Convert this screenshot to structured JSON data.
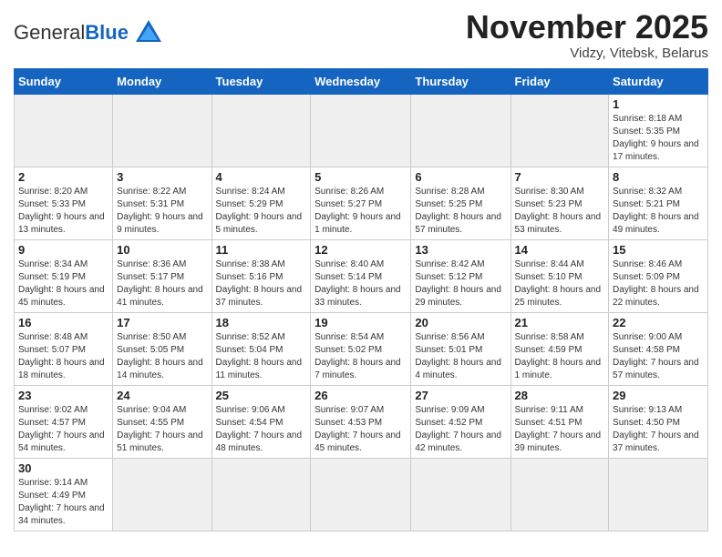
{
  "logo": {
    "general": "General",
    "blue": "Blue"
  },
  "title": "November 2025",
  "subtitle": "Vidzy, Vitebsk, Belarus",
  "days_of_week": [
    "Sunday",
    "Monday",
    "Tuesday",
    "Wednesday",
    "Thursday",
    "Friday",
    "Saturday"
  ],
  "weeks": [
    [
      {
        "day": "",
        "info": ""
      },
      {
        "day": "",
        "info": ""
      },
      {
        "day": "",
        "info": ""
      },
      {
        "day": "",
        "info": ""
      },
      {
        "day": "",
        "info": ""
      },
      {
        "day": "",
        "info": ""
      },
      {
        "day": "1",
        "info": "Sunrise: 8:18 AM\nSunset: 5:35 PM\nDaylight: 9 hours and 17 minutes."
      }
    ],
    [
      {
        "day": "2",
        "info": "Sunrise: 8:20 AM\nSunset: 5:33 PM\nDaylight: 9 hours and 13 minutes."
      },
      {
        "day": "3",
        "info": "Sunrise: 8:22 AM\nSunset: 5:31 PM\nDaylight: 9 hours and 9 minutes."
      },
      {
        "day": "4",
        "info": "Sunrise: 8:24 AM\nSunset: 5:29 PM\nDaylight: 9 hours and 5 minutes."
      },
      {
        "day": "5",
        "info": "Sunrise: 8:26 AM\nSunset: 5:27 PM\nDaylight: 9 hours and 1 minute."
      },
      {
        "day": "6",
        "info": "Sunrise: 8:28 AM\nSunset: 5:25 PM\nDaylight: 8 hours and 57 minutes."
      },
      {
        "day": "7",
        "info": "Sunrise: 8:30 AM\nSunset: 5:23 PM\nDaylight: 8 hours and 53 minutes."
      },
      {
        "day": "8",
        "info": "Sunrise: 8:32 AM\nSunset: 5:21 PM\nDaylight: 8 hours and 49 minutes."
      }
    ],
    [
      {
        "day": "9",
        "info": "Sunrise: 8:34 AM\nSunset: 5:19 PM\nDaylight: 8 hours and 45 minutes."
      },
      {
        "day": "10",
        "info": "Sunrise: 8:36 AM\nSunset: 5:17 PM\nDaylight: 8 hours and 41 minutes."
      },
      {
        "day": "11",
        "info": "Sunrise: 8:38 AM\nSunset: 5:16 PM\nDaylight: 8 hours and 37 minutes."
      },
      {
        "day": "12",
        "info": "Sunrise: 8:40 AM\nSunset: 5:14 PM\nDaylight: 8 hours and 33 minutes."
      },
      {
        "day": "13",
        "info": "Sunrise: 8:42 AM\nSunset: 5:12 PM\nDaylight: 8 hours and 29 minutes."
      },
      {
        "day": "14",
        "info": "Sunrise: 8:44 AM\nSunset: 5:10 PM\nDaylight: 8 hours and 25 minutes."
      },
      {
        "day": "15",
        "info": "Sunrise: 8:46 AM\nSunset: 5:09 PM\nDaylight: 8 hours and 22 minutes."
      }
    ],
    [
      {
        "day": "16",
        "info": "Sunrise: 8:48 AM\nSunset: 5:07 PM\nDaylight: 8 hours and 18 minutes."
      },
      {
        "day": "17",
        "info": "Sunrise: 8:50 AM\nSunset: 5:05 PM\nDaylight: 8 hours and 14 minutes."
      },
      {
        "day": "18",
        "info": "Sunrise: 8:52 AM\nSunset: 5:04 PM\nDaylight: 8 hours and 11 minutes."
      },
      {
        "day": "19",
        "info": "Sunrise: 8:54 AM\nSunset: 5:02 PM\nDaylight: 8 hours and 7 minutes."
      },
      {
        "day": "20",
        "info": "Sunrise: 8:56 AM\nSunset: 5:01 PM\nDaylight: 8 hours and 4 minutes."
      },
      {
        "day": "21",
        "info": "Sunrise: 8:58 AM\nSunset: 4:59 PM\nDaylight: 8 hours and 1 minute."
      },
      {
        "day": "22",
        "info": "Sunrise: 9:00 AM\nSunset: 4:58 PM\nDaylight: 7 hours and 57 minutes."
      }
    ],
    [
      {
        "day": "23",
        "info": "Sunrise: 9:02 AM\nSunset: 4:57 PM\nDaylight: 7 hours and 54 minutes."
      },
      {
        "day": "24",
        "info": "Sunrise: 9:04 AM\nSunset: 4:55 PM\nDaylight: 7 hours and 51 minutes."
      },
      {
        "day": "25",
        "info": "Sunrise: 9:06 AM\nSunset: 4:54 PM\nDaylight: 7 hours and 48 minutes."
      },
      {
        "day": "26",
        "info": "Sunrise: 9:07 AM\nSunset: 4:53 PM\nDaylight: 7 hours and 45 minutes."
      },
      {
        "day": "27",
        "info": "Sunrise: 9:09 AM\nSunset: 4:52 PM\nDaylight: 7 hours and 42 minutes."
      },
      {
        "day": "28",
        "info": "Sunrise: 9:11 AM\nSunset: 4:51 PM\nDaylight: 7 hours and 39 minutes."
      },
      {
        "day": "29",
        "info": "Sunrise: 9:13 AM\nSunset: 4:50 PM\nDaylight: 7 hours and 37 minutes."
      }
    ],
    [
      {
        "day": "30",
        "info": "Sunrise: 9:14 AM\nSunset: 4:49 PM\nDaylight: 7 hours and 34 minutes."
      },
      {
        "day": "",
        "info": ""
      },
      {
        "day": "",
        "info": ""
      },
      {
        "day": "",
        "info": ""
      },
      {
        "day": "",
        "info": ""
      },
      {
        "day": "",
        "info": ""
      },
      {
        "day": "",
        "info": ""
      }
    ]
  ]
}
